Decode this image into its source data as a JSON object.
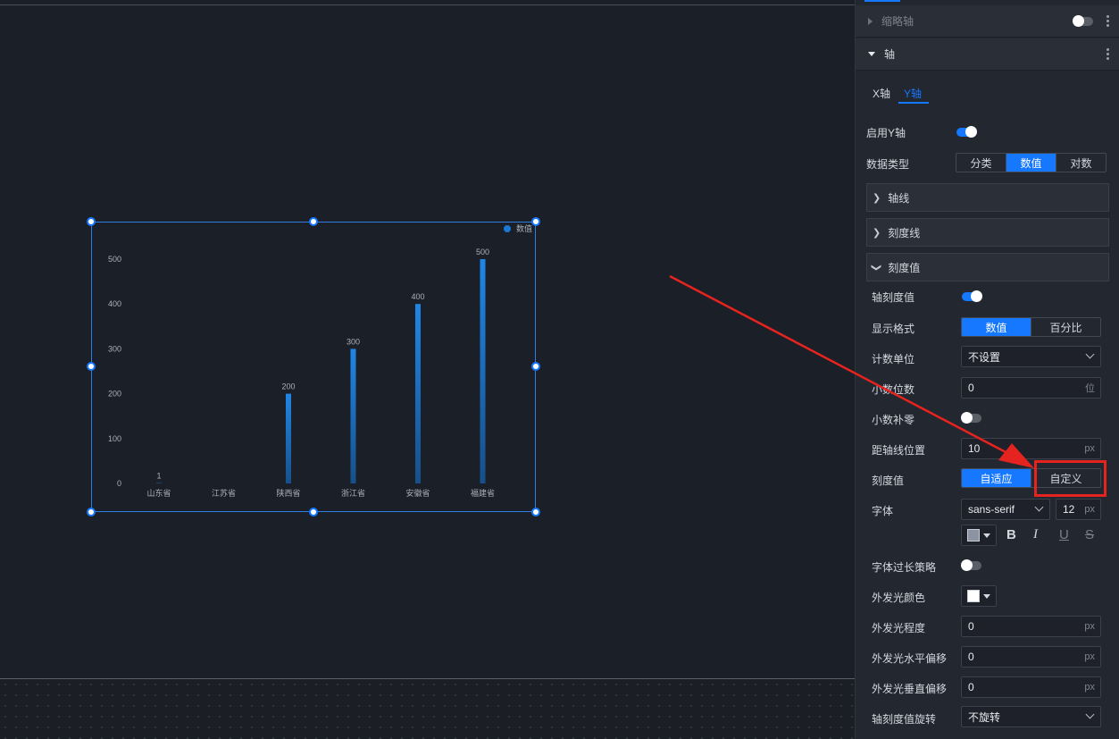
{
  "chart": {
    "legend": "数值",
    "categories": [
      "山东省",
      "江苏省",
      "陕西省",
      "浙江省",
      "安徽省",
      "福建省"
    ],
    "values": [
      1,
      0,
      200,
      300,
      400,
      500
    ],
    "y_ticks": [
      "500",
      "400",
      "300",
      "200",
      "100",
      "0"
    ],
    "value_labels": [
      "1",
      "",
      "200",
      "300",
      "400",
      "500"
    ]
  },
  "chart_data": {
    "type": "bar",
    "categories": [
      "山东省",
      "江苏省",
      "陕西省",
      "浙江省",
      "安徽省",
      "福建省"
    ],
    "series": [
      {
        "name": "数值",
        "values": [
          1,
          0,
          200,
          300,
          400,
          500
        ]
      }
    ],
    "ylim": [
      0,
      500
    ],
    "legend_position": "top-right"
  },
  "panel": {
    "collapsed_section": "缩略轴",
    "axis_section": "轴",
    "tabs": [
      "X轴",
      "Y轴"
    ],
    "enable_y_axis_label": "启用Y轴",
    "data_type_label": "数据类型",
    "data_type_options": [
      "分类",
      "数值",
      "对数"
    ],
    "axis_line": "轴线",
    "tick_line": "刻度线",
    "tick_value": "刻度值",
    "axis_tick_value_label": "轴刻度值",
    "display_format_label": "显示格式",
    "display_format_options": [
      "数值",
      "百分比"
    ],
    "count_unit_label": "计数单位",
    "count_unit_value": "不设置",
    "decimals_label": "小数位数",
    "decimals_value": "0",
    "decimals_unit": "位",
    "pad_zero_label": "小数补零",
    "axis_distance_label": "距轴线位置",
    "axis_distance_value": "10",
    "px": "px",
    "tick_mode_label": "刻度值",
    "tick_mode_options": [
      "自适应",
      "自定义"
    ],
    "font_label": "字体",
    "font_value": "sans-serif",
    "font_size_value": "12",
    "overflow_label": "字体过长策略",
    "glow_color_label": "外发光颜色",
    "glow_level_label": "外发光程度",
    "glow_level_value": "0",
    "glow_x_label": "外发光水平偏移",
    "glow_x_value": "0",
    "glow_y_label": "外发光垂直偏移",
    "glow_y_value": "0",
    "rotate_label": "轴刻度值旋转",
    "rotate_value": "不旋转",
    "bold": "B",
    "italic": "I",
    "underline": "U",
    "strike": "S"
  },
  "colors": {
    "accent": "#1677ff",
    "bar": "#1a78d6",
    "annotation": "#e5231f"
  }
}
